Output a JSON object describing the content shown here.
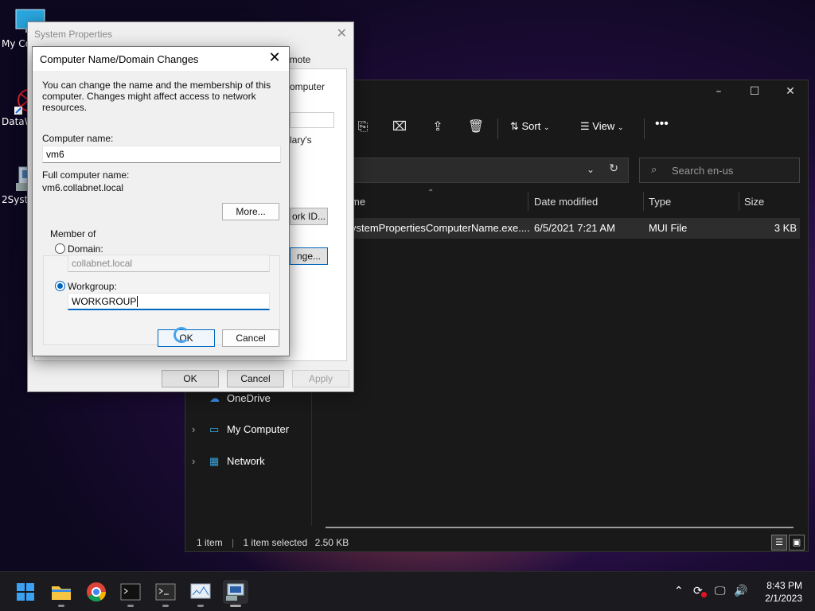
{
  "desktop": {
    "icons": [
      {
        "label": "My Co",
        "icon": "monitor-icon"
      },
      {
        "label": "DataW",
        "icon": "datawarehouse-icon"
      },
      {
        "label": "2Syste",
        "icon": "system-tool-icon"
      }
    ]
  },
  "explorer": {
    "toolbar": {
      "sort_label": "Sort",
      "view_label": "View"
    },
    "search_placeholder": "Search en-us",
    "columns": [
      "me",
      "Date modified",
      "Type",
      "Size"
    ],
    "file": {
      "name": "ystemPropertiesComputerName.exe....",
      "date": "6/5/2021 7:21 AM",
      "type": "MUI File",
      "size": "3 KB"
    },
    "nav": [
      {
        "label": "OneDrive",
        "icon": "onedrive-icon"
      },
      {
        "label": "My Computer",
        "icon": "computer-icon"
      },
      {
        "label": "Network",
        "icon": "network-icon"
      }
    ],
    "status": {
      "count": "1 item",
      "selected": "1 item selected",
      "size": "2.50 KB"
    }
  },
  "system_properties": {
    "title": "System Properties",
    "tab_remote": "emote",
    "frag_computer": "omputer",
    "frag_lary": "lary's",
    "network_id_button": "ork ID...",
    "change_button": "nge...",
    "ok": "OK",
    "cancel": "Cancel",
    "apply": "Apply"
  },
  "dialog": {
    "title": "Computer Name/Domain Changes",
    "intro": "You can change the name and the membership of this computer. Changes might affect access to network resources.",
    "computer_name_label": "Computer name:",
    "computer_name_value": "vm6",
    "full_name_label": "Full computer name:",
    "full_name_value": "vm6.collabnet.local",
    "more_button": "More...",
    "member_of_label": "Member of",
    "domain_label": "Domain:",
    "domain_value": "collabnet.local",
    "workgroup_label": "Workgroup:",
    "workgroup_value": "WORKGROUP",
    "ok": "OK",
    "cancel": "Cancel"
  },
  "taskbar": {
    "apps": [
      "start-icon",
      "file-explorer-icon",
      "chrome-icon",
      "terminal-icon",
      "powershell-icon",
      "monitor-app-icon",
      "system-properties-icon"
    ],
    "time": "8:43 PM",
    "date": "2/1/2023"
  },
  "colors": {
    "accent": "#0067c0",
    "explorer_bg": "#191919",
    "dialog_bg": "#f0f0f0"
  }
}
